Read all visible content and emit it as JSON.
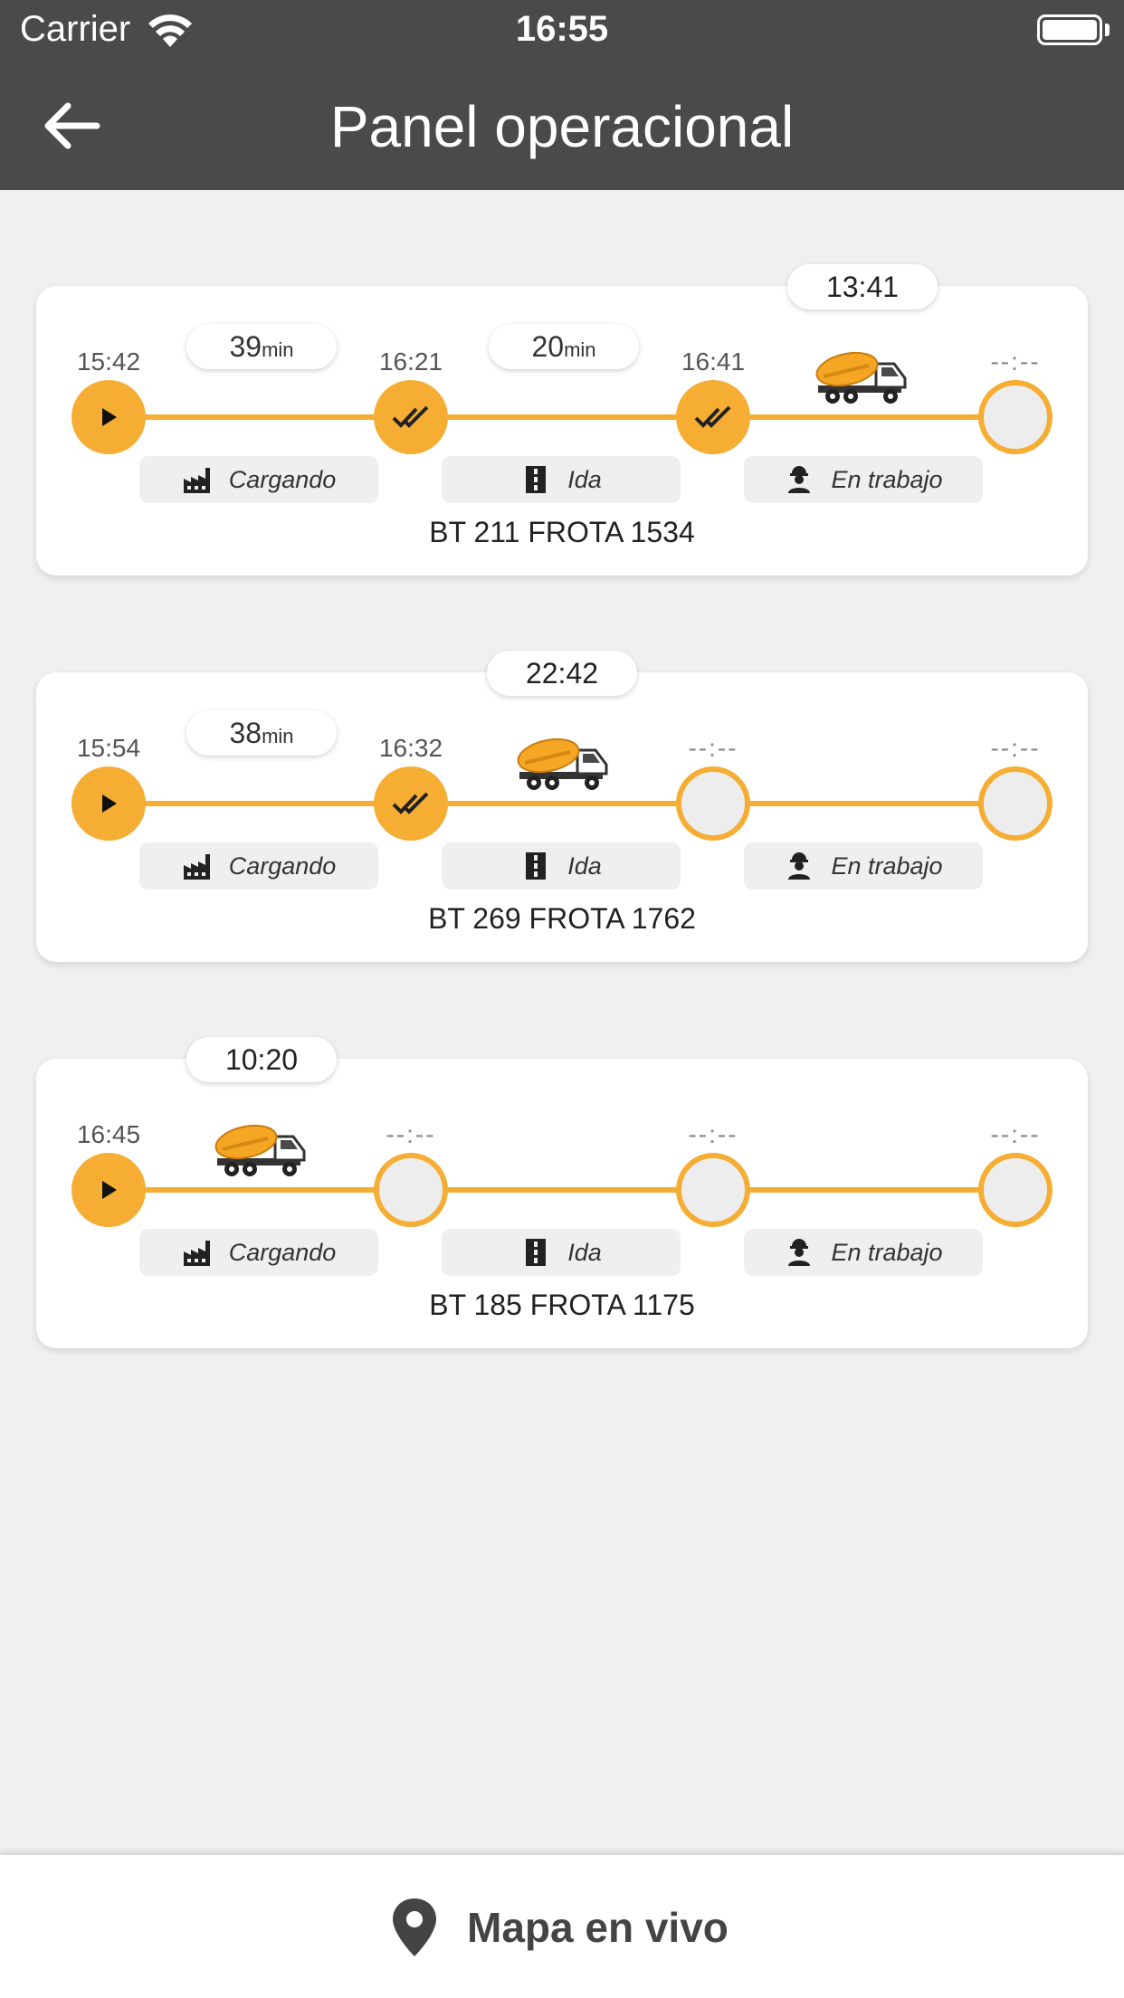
{
  "status_bar": {
    "carrier": "Carrier",
    "time": "16:55"
  },
  "header": {
    "title": "Panel operacional"
  },
  "stages": {
    "loading": "Cargando",
    "going": "Ida",
    "working": "En trabajo"
  },
  "trips": [
    {
      "vehicle": "BT 211 FROTA 1534",
      "elapsed": "13:41",
      "times": [
        "15:42",
        "16:21",
        "16:41",
        "--:--"
      ],
      "durations": [
        "39",
        "20"
      ],
      "duration_unit": "min"
    },
    {
      "vehicle": "BT 269 FROTA 1762",
      "elapsed": "22:42",
      "times": [
        "15:54",
        "16:32",
        "--:--",
        "--:--"
      ],
      "durations": [
        "38"
      ],
      "duration_unit": "min"
    },
    {
      "vehicle": "BT 185 FROTA 1175",
      "elapsed": "10:20",
      "times": [
        "16:45",
        "--:--",
        "--:--",
        "--:--"
      ],
      "durations": [],
      "duration_unit": "min"
    }
  ],
  "bottom_nav": {
    "map_label": "Mapa en vivo"
  },
  "colors": {
    "accent": "#f5ad34",
    "header_bg": "#4a4a4a",
    "page_bg": "#f0f0f0"
  },
  "icons": {
    "back": "arrow-left-icon",
    "start": "play-icon",
    "done": "double-check-icon",
    "loading": "factory-icon",
    "going": "road-icon",
    "working": "worker-icon",
    "vehicle": "concrete-mixer-truck-icon",
    "map": "map-pin-icon"
  }
}
